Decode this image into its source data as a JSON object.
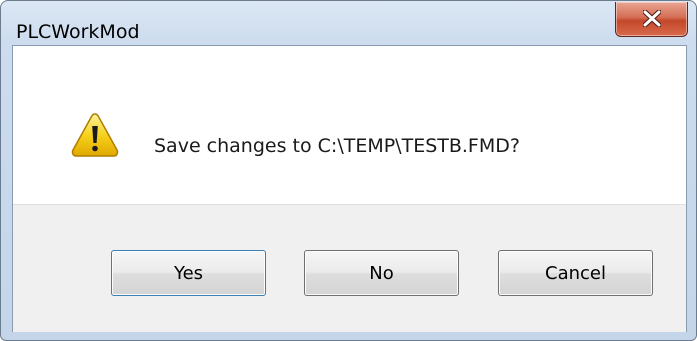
{
  "window": {
    "title": "PLCWorkMod"
  },
  "dialog": {
    "icon": "warning-icon",
    "message": "Save changes to C:\\TEMP\\TESTB.FMD?"
  },
  "buttons": {
    "yes": "Yes",
    "no": "No",
    "cancel": "Cancel"
  },
  "colors": {
    "close_button": "#c4482b",
    "warning_yellow": "#f5c400"
  }
}
